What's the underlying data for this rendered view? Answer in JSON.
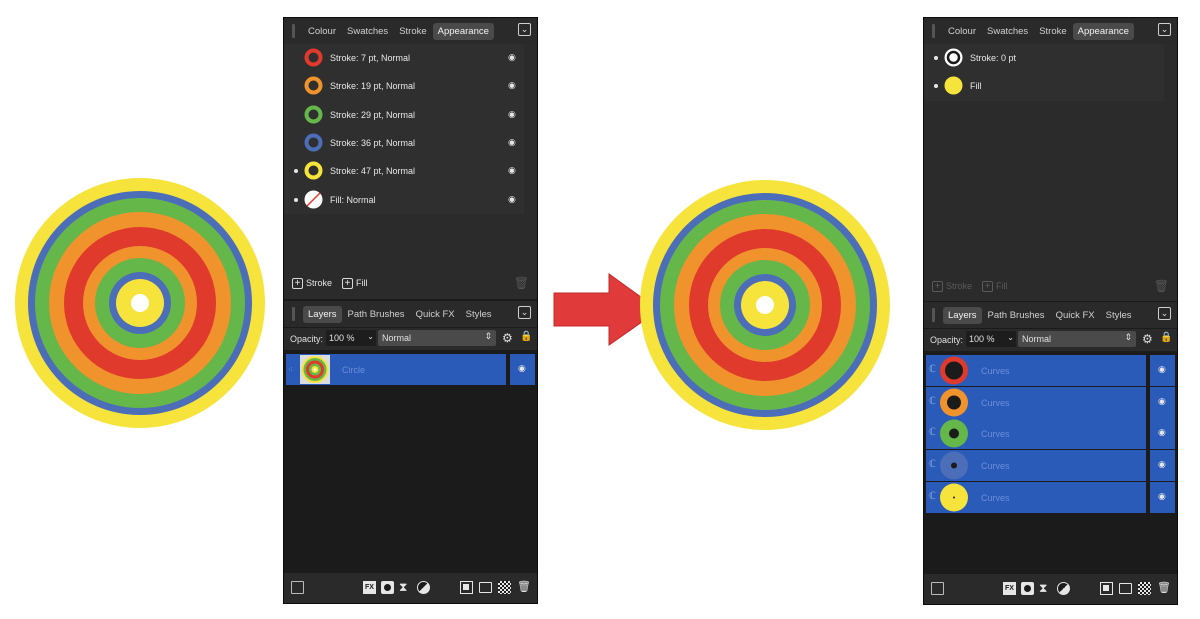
{
  "left_panel": {
    "tabs": [
      "Colour",
      "Swatches",
      "Stroke",
      "Appearance"
    ],
    "active_tab": "Appearance",
    "appearance_items": [
      {
        "label": "Stroke: 7 pt, Normal",
        "color": "#e03a2c",
        "dot": false
      },
      {
        "label": "Stroke: 19 pt, Normal",
        "color": "#f0932c",
        "dot": false
      },
      {
        "label": "Stroke: 29 pt, Normal",
        "color": "#65b74a",
        "dot": false
      },
      {
        "label": "Stroke: 36 pt, Normal",
        "color": "#4c6db8",
        "dot": false
      },
      {
        "label": "Stroke: 47 pt, Normal",
        "color": "#f6e43c",
        "dot": true
      },
      {
        "label": "Fill: Normal",
        "color": "none",
        "dot": true
      }
    ],
    "add_stroke_label": "Stroke",
    "add_fill_label": "Fill",
    "layers_tabs": [
      "Layers",
      "Path Brushes",
      "Quick FX",
      "Styles"
    ],
    "active_layers_tab": "Layers",
    "opacity_label": "Opacity:",
    "opacity_value": "100 %",
    "blend_mode": "Normal",
    "layers": [
      {
        "name": "Circle"
      }
    ],
    "bottom_icons": [
      "edit-icon",
      "fx-icon",
      "mask-icon",
      "hourglass-icon",
      "adjustment-icon",
      "copy-icon",
      "folder-icon",
      "checker-icon",
      "trash-icon"
    ]
  },
  "right_panel": {
    "tabs": [
      "Colour",
      "Swatches",
      "Stroke",
      "Appearance"
    ],
    "active_tab": "Appearance",
    "appearance_items": [
      {
        "label": "Stroke: 0 pt",
        "color": "#ffffff",
        "dot": true
      },
      {
        "label": "Fill",
        "color": "#f6e43c",
        "dot": true
      }
    ],
    "add_stroke_label": "Stroke",
    "add_fill_label": "Fill",
    "layers_tabs": [
      "Layers",
      "Path Brushes",
      "Quick FX",
      "Styles"
    ],
    "active_layers_tab": "Layers",
    "opacity_label": "Opacity:",
    "opacity_value": "100 %",
    "blend_mode": "Normal",
    "layers": [
      {
        "name": "Curves",
        "ring_color": "#e03a2c"
      },
      {
        "name": "Curves",
        "ring_color": "#f0932c"
      },
      {
        "name": "Curves",
        "ring_color": "#65b74a"
      },
      {
        "name": "Curves",
        "ring_color": "#4c6db8"
      },
      {
        "name": "Curves",
        "ring_color": "#f6e43c"
      }
    ]
  },
  "colors": {
    "yellow": "#f6e43c",
    "blue": "#4c6db8",
    "green": "#65b74a",
    "orange": "#f0932c",
    "red": "#e03a2c",
    "arrow": "#e03a3a",
    "layer_selected": "#2a5bb8"
  }
}
